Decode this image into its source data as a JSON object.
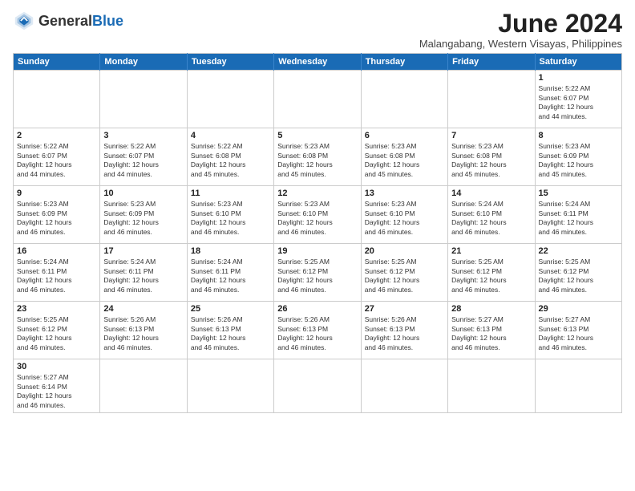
{
  "header": {
    "logo_general": "General",
    "logo_blue": "Blue",
    "month_title": "June 2024",
    "subtitle": "Malangabang, Western Visayas, Philippines"
  },
  "days_of_week": [
    "Sunday",
    "Monday",
    "Tuesday",
    "Wednesday",
    "Thursday",
    "Friday",
    "Saturday"
  ],
  "weeks": [
    [
      {
        "day": "",
        "info": ""
      },
      {
        "day": "",
        "info": ""
      },
      {
        "day": "",
        "info": ""
      },
      {
        "day": "",
        "info": ""
      },
      {
        "day": "",
        "info": ""
      },
      {
        "day": "",
        "info": ""
      },
      {
        "day": "1",
        "info": "Sunrise: 5:22 AM\nSunset: 6:07 PM\nDaylight: 12 hours\nand 44 minutes."
      }
    ],
    [
      {
        "day": "2",
        "info": "Sunrise: 5:22 AM\nSunset: 6:07 PM\nDaylight: 12 hours\nand 44 minutes."
      },
      {
        "day": "3",
        "info": "Sunrise: 5:22 AM\nSunset: 6:07 PM\nDaylight: 12 hours\nand 44 minutes."
      },
      {
        "day": "4",
        "info": "Sunrise: 5:22 AM\nSunset: 6:08 PM\nDaylight: 12 hours\nand 45 minutes."
      },
      {
        "day": "5",
        "info": "Sunrise: 5:23 AM\nSunset: 6:08 PM\nDaylight: 12 hours\nand 45 minutes."
      },
      {
        "day": "6",
        "info": "Sunrise: 5:23 AM\nSunset: 6:08 PM\nDaylight: 12 hours\nand 45 minutes."
      },
      {
        "day": "7",
        "info": "Sunrise: 5:23 AM\nSunset: 6:08 PM\nDaylight: 12 hours\nand 45 minutes."
      },
      {
        "day": "8",
        "info": "Sunrise: 5:23 AM\nSunset: 6:09 PM\nDaylight: 12 hours\nand 45 minutes."
      }
    ],
    [
      {
        "day": "9",
        "info": "Sunrise: 5:23 AM\nSunset: 6:09 PM\nDaylight: 12 hours\nand 46 minutes."
      },
      {
        "day": "10",
        "info": "Sunrise: 5:23 AM\nSunset: 6:09 PM\nDaylight: 12 hours\nand 46 minutes."
      },
      {
        "day": "11",
        "info": "Sunrise: 5:23 AM\nSunset: 6:10 PM\nDaylight: 12 hours\nand 46 minutes."
      },
      {
        "day": "12",
        "info": "Sunrise: 5:23 AM\nSunset: 6:10 PM\nDaylight: 12 hours\nand 46 minutes."
      },
      {
        "day": "13",
        "info": "Sunrise: 5:23 AM\nSunset: 6:10 PM\nDaylight: 12 hours\nand 46 minutes."
      },
      {
        "day": "14",
        "info": "Sunrise: 5:24 AM\nSunset: 6:10 PM\nDaylight: 12 hours\nand 46 minutes."
      },
      {
        "day": "15",
        "info": "Sunrise: 5:24 AM\nSunset: 6:11 PM\nDaylight: 12 hours\nand 46 minutes."
      }
    ],
    [
      {
        "day": "16",
        "info": "Sunrise: 5:24 AM\nSunset: 6:11 PM\nDaylight: 12 hours\nand 46 minutes."
      },
      {
        "day": "17",
        "info": "Sunrise: 5:24 AM\nSunset: 6:11 PM\nDaylight: 12 hours\nand 46 minutes."
      },
      {
        "day": "18",
        "info": "Sunrise: 5:24 AM\nSunset: 6:11 PM\nDaylight: 12 hours\nand 46 minutes."
      },
      {
        "day": "19",
        "info": "Sunrise: 5:25 AM\nSunset: 6:12 PM\nDaylight: 12 hours\nand 46 minutes."
      },
      {
        "day": "20",
        "info": "Sunrise: 5:25 AM\nSunset: 6:12 PM\nDaylight: 12 hours\nand 46 minutes."
      },
      {
        "day": "21",
        "info": "Sunrise: 5:25 AM\nSunset: 6:12 PM\nDaylight: 12 hours\nand 46 minutes."
      },
      {
        "day": "22",
        "info": "Sunrise: 5:25 AM\nSunset: 6:12 PM\nDaylight: 12 hours\nand 46 minutes."
      }
    ],
    [
      {
        "day": "23",
        "info": "Sunrise: 5:25 AM\nSunset: 6:12 PM\nDaylight: 12 hours\nand 46 minutes."
      },
      {
        "day": "24",
        "info": "Sunrise: 5:26 AM\nSunset: 6:13 PM\nDaylight: 12 hours\nand 46 minutes."
      },
      {
        "day": "25",
        "info": "Sunrise: 5:26 AM\nSunset: 6:13 PM\nDaylight: 12 hours\nand 46 minutes."
      },
      {
        "day": "26",
        "info": "Sunrise: 5:26 AM\nSunset: 6:13 PM\nDaylight: 12 hours\nand 46 minutes."
      },
      {
        "day": "27",
        "info": "Sunrise: 5:26 AM\nSunset: 6:13 PM\nDaylight: 12 hours\nand 46 minutes."
      },
      {
        "day": "28",
        "info": "Sunrise: 5:27 AM\nSunset: 6:13 PM\nDaylight: 12 hours\nand 46 minutes."
      },
      {
        "day": "29",
        "info": "Sunrise: 5:27 AM\nSunset: 6:13 PM\nDaylight: 12 hours\nand 46 minutes."
      }
    ],
    [
      {
        "day": "30",
        "info": "Sunrise: 5:27 AM\nSunset: 6:14 PM\nDaylight: 12 hours\nand 46 minutes."
      },
      {
        "day": "",
        "info": ""
      },
      {
        "day": "",
        "info": ""
      },
      {
        "day": "",
        "info": ""
      },
      {
        "day": "",
        "info": ""
      },
      {
        "day": "",
        "info": ""
      },
      {
        "day": "",
        "info": ""
      }
    ]
  ]
}
